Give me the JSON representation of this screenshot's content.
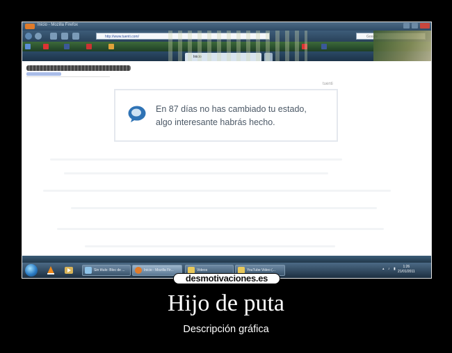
{
  "browser": {
    "window_title": "Inicio - Mozilla Firefox",
    "url": "http://www.tuenti.com/",
    "search_placeholder": "Google",
    "active_tab": "Inicio"
  },
  "page": {
    "brand_label": "tuenti",
    "notice_line1": "En 87 días no has cambiado tu estado,",
    "notice_line2": "algo interesante habrás hecho."
  },
  "taskbar": {
    "tasks": [
      {
        "label": "Sin título: Bloc de ..."
      },
      {
        "label": "Inicio - Mozilla Fir..."
      },
      {
        "label": "Videos"
      },
      {
        "label": "YouTube Video (..."
      }
    ],
    "clock_time": "1:26",
    "clock_date": "21/01/2011"
  },
  "poster": {
    "logo": "desmotivaciones.es",
    "title": "Hijo de puta",
    "description": "Descripción gráfica"
  },
  "colors": {
    "accent_blue": "#2f73b5",
    "notice_text": "#4b5866",
    "poster_bg": "#000000"
  }
}
